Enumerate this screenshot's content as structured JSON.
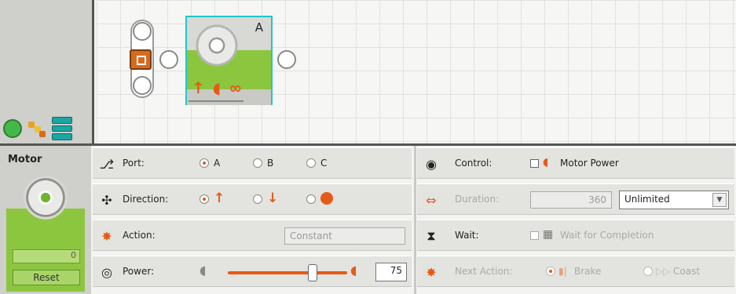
{
  "canvas": {
    "block_port_letter": "A"
  },
  "motor": {
    "title": "Motor",
    "counter_value": "0",
    "reset_label": "Reset"
  },
  "port": {
    "label": "Port:",
    "options": [
      "A",
      "B",
      "C"
    ],
    "selected": "A"
  },
  "direction": {
    "label": "Direction:",
    "options": [
      "forward",
      "backward",
      "stop"
    ],
    "selected": "forward"
  },
  "action": {
    "label": "Action:",
    "value": "Constant"
  },
  "power": {
    "label": "Power:",
    "value": "75",
    "level": 75
  },
  "control": {
    "label": "Control:",
    "checkbox_label": "Motor Power"
  },
  "duration": {
    "label": "Duration:",
    "value": "360",
    "unit": "Unlimited"
  },
  "wait": {
    "label": "Wait:",
    "checkbox_label": "Wait for Completion"
  },
  "next_action": {
    "label": "Next Action:",
    "options": [
      "Brake",
      "Coast"
    ],
    "selected": "Brake"
  },
  "colors": {
    "accent": "#e55b15",
    "block_green": "#8cc63f",
    "selection": "#22c5c9"
  }
}
